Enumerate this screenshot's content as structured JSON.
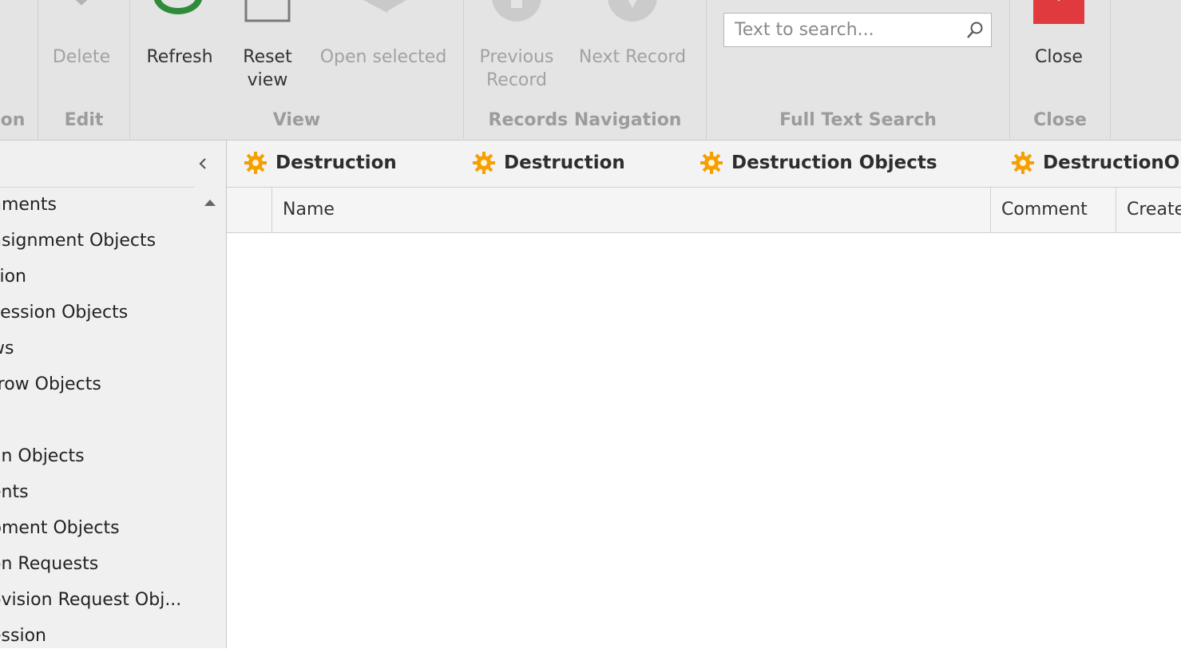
{
  "ribbon": {
    "groups": [
      {
        "label": "on"
      },
      {
        "label": "Edit"
      },
      {
        "label": "View"
      },
      {
        "label": "Records Navigation"
      },
      {
        "label": "Full Text Search"
      },
      {
        "label": "Close"
      }
    ],
    "buttons": {
      "delete": "Delete",
      "refresh": "Refresh",
      "reset_view": "Reset\nview",
      "open_selected": "Open selected",
      "previous_record": "Previous\nRecord",
      "next_record": "Next Record",
      "close": "Close"
    },
    "search": {
      "placeholder": "Text to search...",
      "value": ""
    },
    "colors": {
      "refresh_icon": "#2e8b3a",
      "close_icon": "#e03a3e",
      "disabled": "#a2a2a2"
    }
  },
  "nav": {
    "items": [
      {
        "label": "nments"
      },
      {
        "label": "nsignment Objects"
      },
      {
        "label": "sion"
      },
      {
        "label": "cession Objects"
      },
      {
        "label": "ws"
      },
      {
        "label": "rrow Objects"
      },
      {
        "label": ""
      },
      {
        "label": "an Objects"
      },
      {
        "label": "ents"
      },
      {
        "label": "pment Objects"
      },
      {
        "label": "on Requests"
      },
      {
        "label": "ovision Request Obj..."
      },
      {
        "label": "ession"
      }
    ]
  },
  "tabs": [
    {
      "label": "Destruction"
    },
    {
      "label": "Destruction"
    },
    {
      "label": "Destruction Objects"
    },
    {
      "label": "DestructionOb"
    }
  ],
  "grid": {
    "columns": [
      {
        "label": ""
      },
      {
        "label": "Name"
      },
      {
        "label": "Comment"
      },
      {
        "label": "Create"
      }
    ],
    "rows": []
  },
  "icons": {
    "tab_icon": "gear-icon",
    "tab_icon_color": "#f5a000"
  }
}
